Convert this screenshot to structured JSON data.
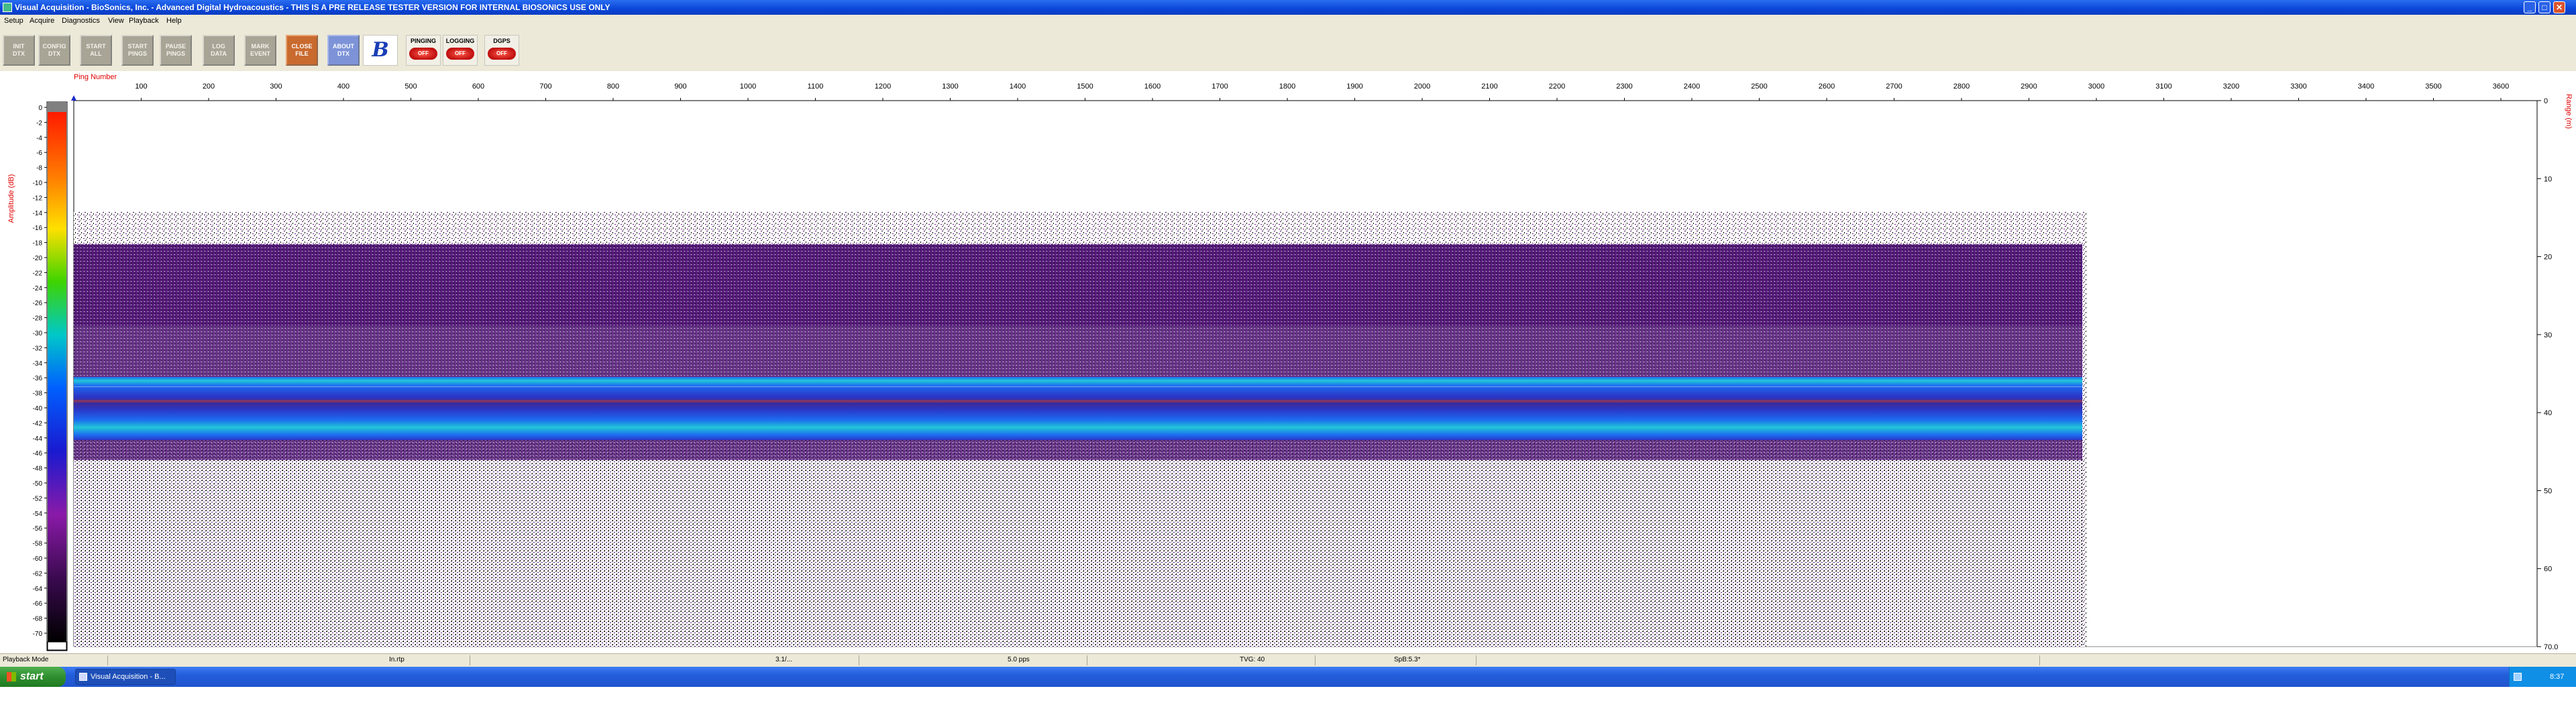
{
  "window": {
    "title": "Visual Acquisition  -  BioSonics, Inc.   -   Advanced Digital Hydroacoustics   -   THIS IS A PRE RELEASE TESTER VERSION FOR INTERNAL BIOSONICS USE ONLY"
  },
  "menu": [
    "Setup",
    "Acquire",
    "Diagnostics",
    "View",
    "Playback",
    "Help"
  ],
  "toolbar": {
    "buttons": [
      {
        "label": "INIT\nDTX"
      },
      {
        "label": "CONFIG\nDTX"
      },
      {
        "label": "START\nALL"
      },
      {
        "label": "START\nPINGS"
      },
      {
        "label": "PAUSE\nPINGS"
      },
      {
        "label": "LOG\nDATA"
      },
      {
        "label": "MARK\nEVENT"
      },
      {
        "label": "CLOSE\nFILE"
      },
      {
        "label": "ABOUT\nDTX"
      }
    ],
    "indicators": [
      {
        "label": "PINGING",
        "state": "OFF"
      },
      {
        "label": "LOGGING",
        "state": "OFF"
      },
      {
        "label": "DGPS",
        "state": "OFF"
      }
    ]
  },
  "echogram": {
    "x_axis_label": "Ping Number",
    "x_ticks": [
      "100",
      "200",
      "300",
      "400",
      "500",
      "600",
      "700",
      "800",
      "900",
      "1000",
      "1100",
      "1200",
      "1300",
      "1400",
      "1500",
      "1600",
      "1700",
      "1800",
      "1900",
      "2000",
      "2100",
      "2200",
      "2300",
      "2400",
      "2500",
      "2600",
      "2700",
      "2800",
      "2900",
      "3000",
      "3100",
      "3200",
      "3300",
      "3400",
      "3500",
      "3600"
    ],
    "left_axis_label": "Amplitude (dB)",
    "amp_ticks": [
      "0",
      "-2",
      "-4",
      "-6",
      "-8",
      "-10",
      "-12",
      "-14",
      "-16",
      "-18",
      "-20",
      "-22",
      "-24",
      "-26",
      "-28",
      "-30",
      "-32",
      "-34",
      "-36",
      "-38",
      "-40",
      "-42",
      "-44",
      "-46",
      "-48",
      "-50",
      "-52",
      "-54",
      "-56",
      "-58",
      "-60",
      "-62",
      "-64",
      "-66",
      "-68",
      "-70"
    ],
    "right_axis_label": "Range (m)",
    "range_ticks": [
      "0",
      "10",
      "20",
      "30",
      "40",
      "50",
      "60",
      "70.0"
    ],
    "colors": {
      "noise": "#6a1a86",
      "band_outer": "#1c6cf0",
      "band_inner": "#22c7d8",
      "band_core": "#2a38c8",
      "band_hot": "#b63a3a"
    }
  },
  "statusbar": {
    "mode": "Playback Mode",
    "file": "In.rtp",
    "field2": "3.1/...",
    "rate": "5.0 pps",
    "tvg": "TVG: 40",
    "spb": "SpB:5.3*"
  },
  "taskbar": {
    "start_label": "start",
    "task_label": "Visual Acquisition  -  B...",
    "clock": "8:37 AM"
  }
}
